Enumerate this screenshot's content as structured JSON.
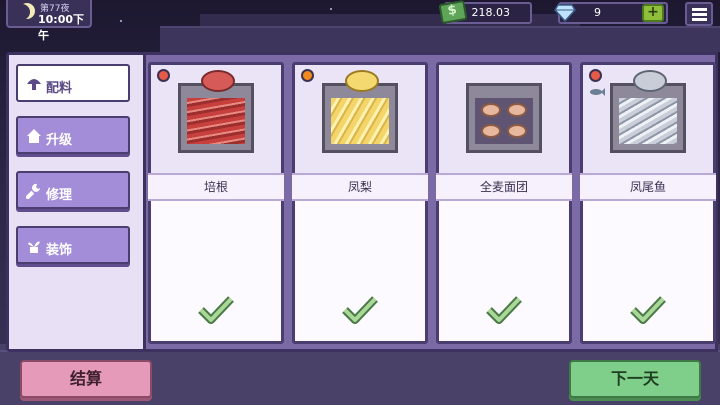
{
  "hud": {
    "night_label": "第77夜",
    "time_label": "10:00下午",
    "money": "218.03",
    "gems": "9",
    "gem_add_label": "+"
  },
  "sidebar": {
    "items": [
      {
        "label": "配料",
        "icon": "mushroom-icon",
        "active": true
      },
      {
        "label": "升级",
        "icon": "house-icon",
        "active": false
      },
      {
        "label": "修理",
        "icon": "wrench-icon",
        "active": false
      },
      {
        "label": "装饰",
        "icon": "plant-icon",
        "active": false
      }
    ]
  },
  "ingredients": [
    {
      "name": "培根",
      "badge": "meat-icon",
      "stocked": true
    },
    {
      "name": "凤梨",
      "badge": "fruit-icon",
      "stocked": true
    },
    {
      "name": "全麦面团",
      "badge": "",
      "stocked": true
    },
    {
      "name": "凤尾鱼",
      "badge": "meat-icon fish-icon",
      "stocked": true
    }
  ],
  "footer": {
    "settle_label": "结算",
    "next_day_label": "下一天"
  },
  "colors": {
    "active_tab": "#ffffff",
    "tab": "#a38cd8",
    "settle": "#e49ab8",
    "next_day": "#7fcf8a",
    "check": "#7fae6f"
  }
}
